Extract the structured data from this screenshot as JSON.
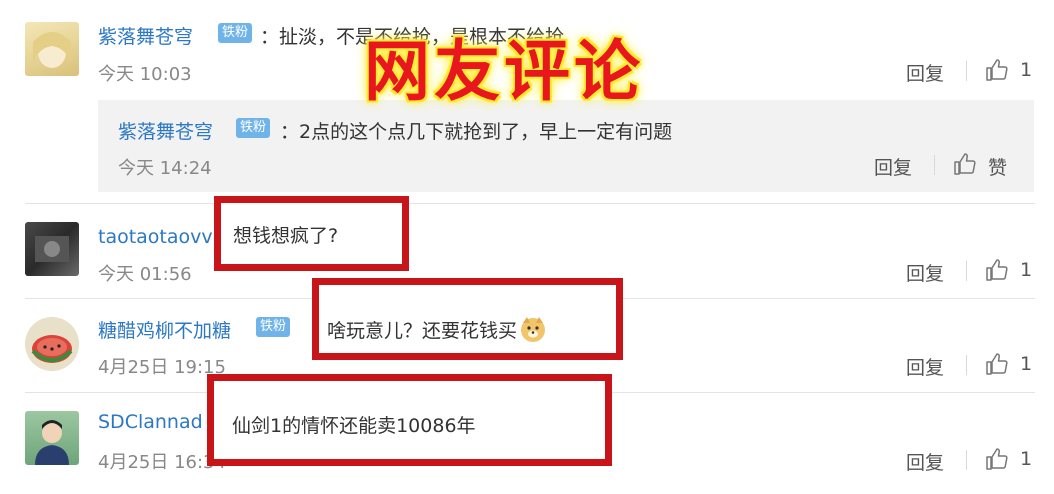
{
  "overlay_title": "网友评论",
  "comments": [
    {
      "username": "紫落舞苍穹",
      "badge": "铁粉",
      "text": "：扯淡，不是不给抢，是根本不给抢",
      "time": "今天 10:03",
      "reply": "回复",
      "likes": "1",
      "nested": {
        "username": "紫落舞苍穹",
        "badge": "铁粉",
        "text": "：2点的这个点几下就抢到了，早上一定有问题",
        "time": "今天 14:24",
        "reply": "回复",
        "likes": "赞"
      }
    },
    {
      "username": "taotaotaovv：",
      "text": "想钱想疯了?",
      "time": "今天 01:56",
      "reply": "回复",
      "likes": "1"
    },
    {
      "username": "糖醋鸡柳不加糖",
      "badge": "铁粉",
      "text": "啥玩意儿？还要花钱买",
      "emoji": "doge-emoji",
      "time": "4月25日 19:15",
      "reply": "回复",
      "likes": "1"
    },
    {
      "username": "SDClannad",
      "text": "仙剑1的情怀还能卖10086年",
      "time": "4月25日 16:34",
      "reply": "回复",
      "likes": "1"
    }
  ],
  "colors": {
    "highlight_box": "#c8151a",
    "username": "#2c78c4",
    "title": "#e8171d",
    "title_glow": "#ffec3a"
  }
}
